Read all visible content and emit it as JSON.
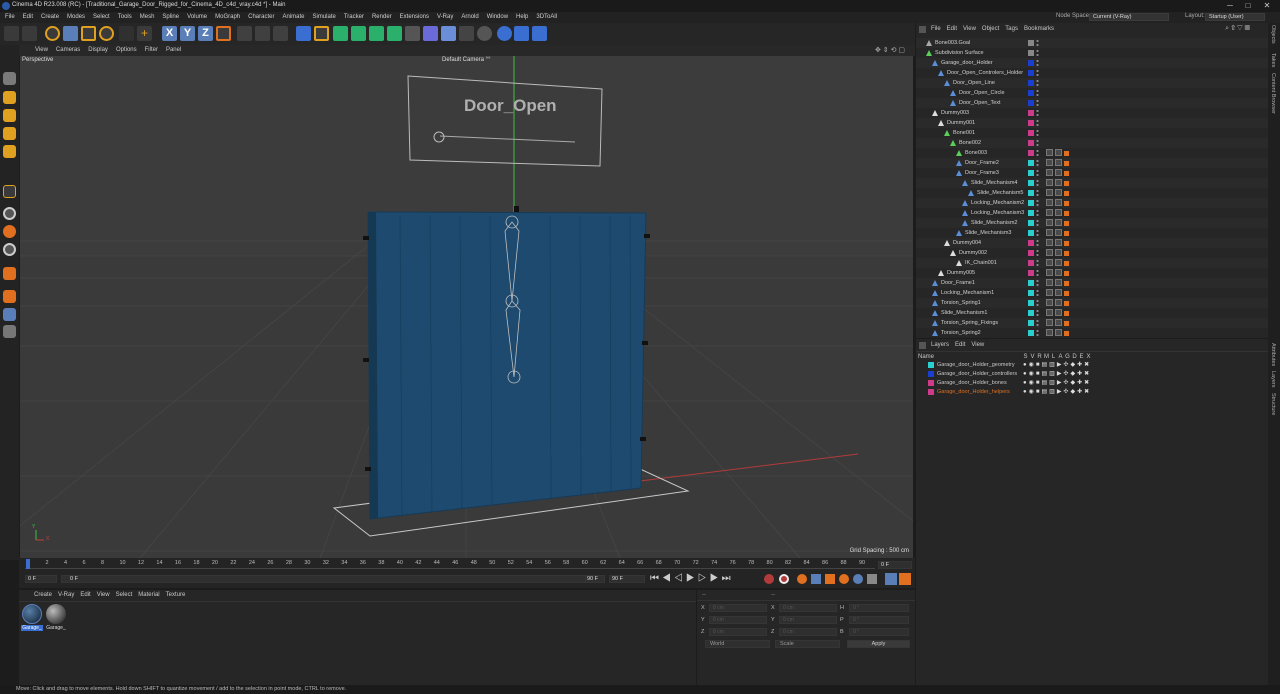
{
  "title": "Cinema 4D R23.008 (RC) - [Traditional_Garage_Door_Rigged_for_Cinema_4D_c4d_vray.c4d *] - Main",
  "window_controls": {
    "minimize": "─",
    "maximize": "□",
    "close": "✕"
  },
  "menu": [
    "File",
    "Edit",
    "Create",
    "Modes",
    "Select",
    "Tools",
    "Mesh",
    "Spline",
    "Volume",
    "MoGraph",
    "Character",
    "Animate",
    "Simulate",
    "Tracker",
    "Render",
    "Extensions",
    "V-Ray",
    "Arnold",
    "Window",
    "Help",
    "3DToAll"
  ],
  "node_space": {
    "label": "Node Space:",
    "value": "Current (V-Ray)"
  },
  "layout": {
    "label": "Layout:",
    "value": "Startup (User)"
  },
  "toolbar_xyz": [
    "X",
    "Y",
    "Z"
  ],
  "viewport_menu": [
    "View",
    "Cameras",
    "Display",
    "Options",
    "Filter",
    "Panel"
  ],
  "viewport": {
    "name": "Perspective",
    "camera": "Default Camera °°",
    "grid_spacing": "Grid Spacing : 500 cm",
    "axis_y": "Y",
    "axis_x": "X",
    "sign_text": "Door_Open",
    "colors": {
      "door": "#1d4a6e",
      "bg": "#3a3a3a"
    }
  },
  "timeline": {
    "ticks": [
      "0",
      "2",
      "4",
      "6",
      "8",
      "10",
      "12",
      "14",
      "16",
      "18",
      "20",
      "22",
      "24",
      "26",
      "28",
      "30",
      "32",
      "34",
      "36",
      "38",
      "40",
      "42",
      "44",
      "46",
      "48",
      "50",
      "52",
      "54",
      "56",
      "58",
      "60",
      "62",
      "64",
      "66",
      "68",
      "70",
      "72",
      "74",
      "76",
      "78",
      "80",
      "82",
      "84",
      "86",
      "88",
      "90"
    ],
    "current": "0 F",
    "start": "0 F",
    "range_start": "0 F",
    "range_end": "90 F",
    "end": "90 F",
    "frame_field": "0 F"
  },
  "material_menu": [
    "Create",
    "V-Ray",
    "Edit",
    "View",
    "Select",
    "Material",
    "Texture"
  ],
  "materials": [
    {
      "label": "Garage_"
    },
    {
      "label": "Garage_"
    }
  ],
  "coords": {
    "header_left": "--",
    "header_right": "--",
    "rows": [
      {
        "a": "X",
        "b": "0 cm",
        "c": "X",
        "d": "0 cm",
        "e": "H",
        "f": "0 °"
      },
      {
        "a": "Y",
        "b": "0 cm",
        "c": "Y",
        "d": "0 cm",
        "e": "P",
        "f": "0 °"
      },
      {
        "a": "Z",
        "b": "0 cm",
        "c": "Z",
        "d": "0 cm",
        "e": "B",
        "f": "0 °"
      }
    ],
    "mode": "World",
    "scale": "Scale",
    "apply": "Apply"
  },
  "obj_menu": [
    "File",
    "Edit",
    "View",
    "Object",
    "Tags",
    "Bookmarks"
  ],
  "objects": [
    {
      "name": "Bone003.Goal",
      "indent": 0,
      "color": "#888888",
      "icon": "#aaaaaa"
    },
    {
      "name": "Subdivision Surface",
      "indent": 0,
      "color": "#888888",
      "icon": "#5ad05a"
    },
    {
      "name": "Garage_door_Holder",
      "indent": 1,
      "color": "#1a3fd0",
      "icon": "#5a8fd8"
    },
    {
      "name": "Door_Open_Controlers_Holder",
      "indent": 2,
      "color": "#1a3fd0",
      "icon": "#5a8fd8"
    },
    {
      "name": "Door_Open_Line",
      "indent": 3,
      "color": "#1a3fd0",
      "icon": "#5a8fd8"
    },
    {
      "name": "Door_Open_Circle",
      "indent": 4,
      "color": "#1a3fd0",
      "icon": "#5a8fd8"
    },
    {
      "name": "Door_Open_Text",
      "indent": 4,
      "color": "#1a3fd0",
      "icon": "#5a8fd8"
    },
    {
      "name": "Dummy003",
      "indent": 1,
      "color": "#d03a8a",
      "icon": "#dddddd"
    },
    {
      "name": "Dummy001",
      "indent": 2,
      "color": "#d03a8a",
      "icon": "#dddddd"
    },
    {
      "name": "Bone001",
      "indent": 3,
      "color": "#d03a8a",
      "icon": "#5ad05a"
    },
    {
      "name": "Bone002",
      "indent": 4,
      "color": "#d03a8a",
      "icon": "#5ad05a"
    },
    {
      "name": "Bone003",
      "indent": 5,
      "color": "#d03a8a",
      "icon": "#5ad05a"
    },
    {
      "name": "Door_Frame2",
      "indent": 5,
      "color": "#2ad0d0",
      "icon": "#5a8fd8"
    },
    {
      "name": "Door_Frame3",
      "indent": 5,
      "color": "#2ad0d0",
      "icon": "#5a8fd8"
    },
    {
      "name": "Slide_Mechanism4",
      "indent": 6,
      "color": "#2ad0d0",
      "icon": "#5a8fd8"
    },
    {
      "name": "Slide_Mechanism5",
      "indent": 7,
      "color": "#2ad0d0",
      "icon": "#5a8fd8"
    },
    {
      "name": "Locking_Mechanism2",
      "indent": 6,
      "color": "#2ad0d0",
      "icon": "#5a8fd8"
    },
    {
      "name": "Locking_Mechanism3",
      "indent": 6,
      "color": "#2ad0d0",
      "icon": "#5a8fd8"
    },
    {
      "name": "Slide_Mechanism2",
      "indent": 6,
      "color": "#2ad0d0",
      "icon": "#5a8fd8"
    },
    {
      "name": "Slide_Mechanism3",
      "indent": 5,
      "color": "#2ad0d0",
      "icon": "#5a8fd8"
    },
    {
      "name": "Dummy004",
      "indent": 3,
      "color": "#d03a8a",
      "icon": "#dddddd"
    },
    {
      "name": "Dummy002",
      "indent": 4,
      "color": "#d03a8a",
      "icon": "#dddddd"
    },
    {
      "name": "IK_Chain001",
      "indent": 5,
      "color": "#d03a8a",
      "icon": "#dddddd"
    },
    {
      "name": "Dummy005",
      "indent": 2,
      "color": "#d03a8a",
      "icon": "#dddddd"
    },
    {
      "name": "Door_Frame1",
      "indent": 1,
      "color": "#2ad0d0",
      "icon": "#5a8fd8"
    },
    {
      "name": "Locking_Mechanism1",
      "indent": 1,
      "color": "#2ad0d0",
      "icon": "#5a8fd8"
    },
    {
      "name": "Torsion_Spring1",
      "indent": 1,
      "color": "#2ad0d0",
      "icon": "#5a8fd8"
    },
    {
      "name": "Slide_Mechanism1",
      "indent": 1,
      "color": "#2ad0d0",
      "icon": "#5a8fd8"
    },
    {
      "name": "Torsion_Spring_Fixings",
      "indent": 1,
      "color": "#2ad0d0",
      "icon": "#5a8fd8"
    },
    {
      "name": "Torsion_Spring2",
      "indent": 1,
      "color": "#2ad0d0",
      "icon": "#5a8fd8"
    }
  ],
  "layers_menu": [
    "Layers",
    "Edit",
    "View"
  ],
  "layers_header": {
    "name": "Name",
    "cols": [
      "S",
      "V",
      "R",
      "M",
      "L",
      "A",
      "G",
      "D",
      "E",
      "X"
    ]
  },
  "layers": [
    {
      "name": "Garage_door_Holder_geometry",
      "color": "#2ad0d0",
      "text": "#c8c8c8"
    },
    {
      "name": "Garage_door_Holder_controllers",
      "color": "#1a3fd0",
      "text": "#c8c8c8"
    },
    {
      "name": "Garage_door_Holder_bones",
      "color": "#d03a8a",
      "text": "#c8c8c8"
    },
    {
      "name": "Garage_door_Holder_helpers",
      "color": "#d03a8a",
      "text": "#e07020"
    }
  ],
  "right_tabs": [
    "Objects",
    "Takes",
    "Content Browser",
    "Attributes",
    "Layers",
    "Structure"
  ],
  "status": "Move: Click and drag to move elements. Hold down SHIFT to quantize movement / add to the selection in point mode, CTRL to remove."
}
